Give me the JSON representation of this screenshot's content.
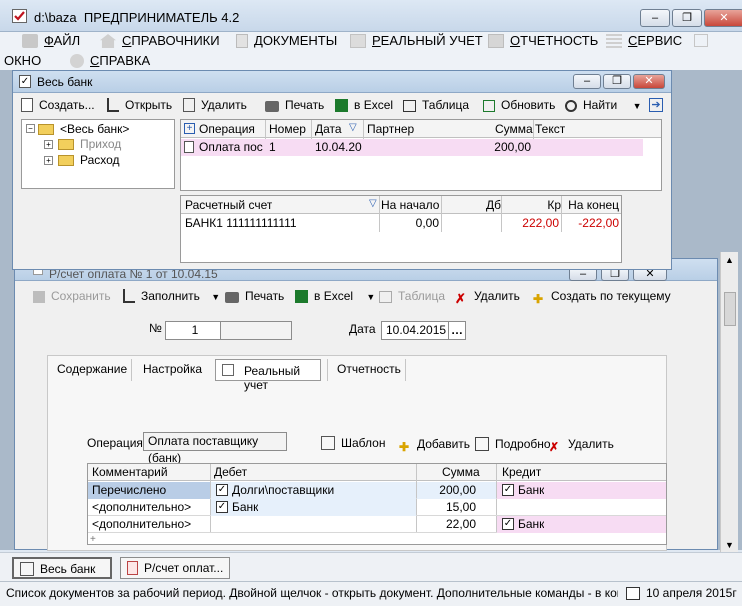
{
  "app": {
    "path": "d:\\baza",
    "title": "ПРЕДПРИНИМАТЕЛЬ 4.2"
  },
  "menu": {
    "row1": [
      {
        "u": "Ф",
        "rest": "АЙЛ",
        "icon": "folder-icon"
      },
      {
        "u": "С",
        "rest": "ПРАВОЧНИКИ",
        "icon": "house-icon"
      },
      {
        "u": "Д",
        "rest": "ОКУМЕНТЫ",
        "icon": "document-icon"
      },
      {
        "u": "Р",
        "rest": "ЕАЛЬНЫЙ УЧЕТ",
        "icon": "ledger-icon"
      },
      {
        "u": "О",
        "rest": "ТЧЕТНОСТЬ",
        "icon": "report-icon"
      },
      {
        "u": "С",
        "rest": "ЕРВИС",
        "icon": "service-icon"
      }
    ],
    "window": "ОКНО",
    "help": {
      "u": "С",
      "rest": "ПРАВКА"
    }
  },
  "bank": {
    "title": "Весь банк",
    "toolbar": {
      "create": "Создать...",
      "open": "Открыть",
      "delete": "Удалить",
      "print": "Печать",
      "excel": "в Excel",
      "table": "Таблица",
      "refresh": "Обновить",
      "find": "Найти"
    },
    "tree": {
      "root": "<Весь банк>",
      "income": "Приход",
      "expense": "Расход"
    },
    "grid": {
      "headers": [
        "Операция",
        "Номер",
        "Дата",
        "Партнер",
        "Сумма",
        "Текст"
      ],
      "row": {
        "operation": "Оплата пос",
        "number": "1",
        "date": "10.04.20",
        "partner": "",
        "sum": "200,00",
        "text": ""
      }
    },
    "accounts": {
      "headers": [
        "Расчетный счет",
        "На начало",
        "Дб",
        "Кр",
        "На конец"
      ],
      "row": {
        "account": "БАНК1 111111111111",
        "start": "0,00",
        "debit": "",
        "credit": "222,00",
        "end": "-222,00"
      }
    }
  },
  "invoice": {
    "title": "Р/счет оплата № 1 от 10.04.15",
    "toolbar": {
      "save": "Сохранить",
      "fill": "Заполнить",
      "print": "Печать",
      "excel": "в Excel",
      "table": "Таблица",
      "delete": "Удалить",
      "create_by_current": "Создать по текущему"
    },
    "number_label": "№",
    "number": "1",
    "date_label": "Дата",
    "date": "10.04.2015",
    "tabs": [
      "Содержание",
      "Настройка",
      "Реальный учет",
      "Отчетность"
    ],
    "operation_label": "Операция",
    "operation_value": "Оплата поставщику (банк)",
    "template": "Шаблон",
    "add": "Добавить",
    "details": "Подробно",
    "remove": "Удалить",
    "grid": {
      "headers": [
        "Комментарий",
        "Дебет",
        "Сумма",
        "Кредит"
      ],
      "rows": [
        {
          "comment": "Перечислено",
          "debit": "Долги\\поставщики",
          "sum": "200,00",
          "credit": "Банк"
        },
        {
          "comment": "<дополнительно>",
          "debit": "Банк",
          "sum": "15,00",
          "credit": ""
        },
        {
          "comment": "<дополнительно>",
          "debit": "",
          "sum": "22,00",
          "credit": "Банк"
        }
      ]
    }
  },
  "taskbar": {
    "bank": "Весь банк",
    "invoice": "Р/счет оплат..."
  },
  "status": {
    "hint": "Список документов за рабочий период. Двойной щелчок - открыть документ. Дополнительные команды - в контекс",
    "date": "10 апреля 2015г"
  },
  "colors": {
    "selected_row": "#f7dcf3",
    "credit_red": "#cc0000",
    "accent_green": "#1c7a2c"
  }
}
